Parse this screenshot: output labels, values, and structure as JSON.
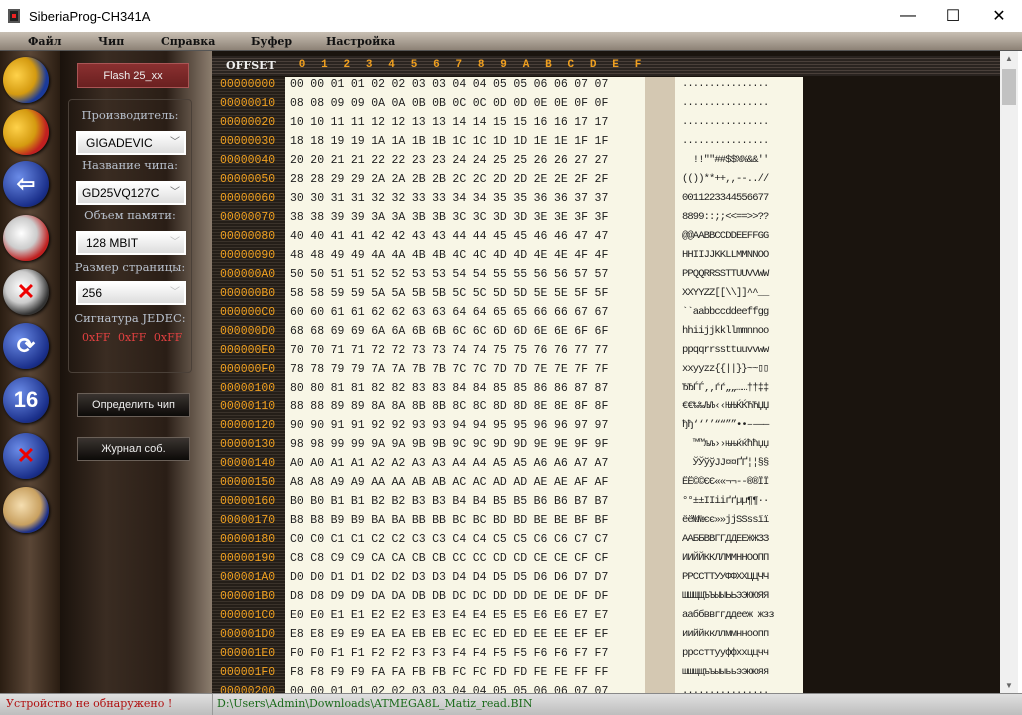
{
  "window": {
    "title": "SiberiaProg-CH341A",
    "minimize": "—",
    "maximize": "☐",
    "close": "✕"
  },
  "menu": [
    "Файл",
    "Чип",
    "Справка",
    "Буфер",
    "Настройка"
  ],
  "toolbar": [
    {
      "icon": "open-folder-icon"
    },
    {
      "icon": "save-folder-icon"
    },
    {
      "icon": "read-chip-icon"
    },
    {
      "icon": "write-chip-icon"
    },
    {
      "icon": "erase-chip-icon"
    },
    {
      "icon": "verify-icon"
    },
    {
      "icon": "hex-16-icon",
      "label": "16"
    },
    {
      "icon": "auto-program-icon"
    },
    {
      "icon": "edit-icon"
    }
  ],
  "panel": {
    "flash_button": "Flash 25_xx",
    "manufacturer_label": "Производитель:",
    "manufacturer": "GIGADEVIC",
    "chip_name_label": "Название чипа:",
    "chip_name": "GD25VQ127C",
    "memory_label": "Объем памяти:",
    "memory": "128 MBIT",
    "page_label": "Размер страницы:",
    "page_size": "256",
    "jedec_label": "Сигнатура JEDEC:",
    "jedec": "0xFF  0xFF  0xFF",
    "detect_button": "Определить чип",
    "log_button": "Журнал соб."
  },
  "hex": {
    "offset_header": "OFFSET",
    "columns": [
      "0",
      "1",
      "2",
      "3",
      "4",
      "5",
      "6",
      "7",
      "8",
      "9",
      "A",
      "B",
      "C",
      "D",
      "E",
      "F"
    ],
    "rows": [
      {
        "o": "00000000",
        "h": "00 00 01 01 02 02 03 03 04 04 05 05 06 06 07 07",
        "a": "................"
      },
      {
        "o": "00000010",
        "h": "08 08 09 09 0A 0A 0B 0B 0C 0C 0D 0D 0E 0E 0F 0F",
        "a": "................"
      },
      {
        "o": "00000020",
        "h": "10 10 11 11 12 12 13 13 14 14 15 15 16 16 17 17",
        "a": "................"
      },
      {
        "o": "00000030",
        "h": "18 18 19 19 1A 1A 1B 1B 1C 1C 1D 1D 1E 1E 1F 1F",
        "a": "................"
      },
      {
        "o": "00000040",
        "h": "20 20 21 21 22 22 23 23 24 24 25 25 26 26 27 27",
        "a": "  !!\"\"##$$%%&&''"
      },
      {
        "o": "00000050",
        "h": "28 28 29 29 2A 2A 2B 2B 2C 2C 2D 2D 2E 2E 2F 2F",
        "a": "(())**++,,--..//"
      },
      {
        "o": "00000060",
        "h": "30 30 31 31 32 32 33 33 34 34 35 35 36 36 37 37",
        "a": "0011223344556677"
      },
      {
        "o": "00000070",
        "h": "38 38 39 39 3A 3A 3B 3B 3C 3C 3D 3D 3E 3E 3F 3F",
        "a": "8899::;;<<==>>??"
      },
      {
        "o": "00000080",
        "h": "40 40 41 41 42 42 43 43 44 44 45 45 46 46 47 47",
        "a": "@@AABBCCDDEEFFGG"
      },
      {
        "o": "00000090",
        "h": "48 48 49 49 4A 4A 4B 4B 4C 4C 4D 4D 4E 4E 4F 4F",
        "a": "HHIIJJKKLLMMNNOO"
      },
      {
        "o": "000000A0",
        "h": "50 50 51 51 52 52 53 53 54 54 55 55 56 56 57 57",
        "a": "PPQQRRSSTTUUVVWW"
      },
      {
        "o": "000000B0",
        "h": "58 58 59 59 5A 5A 5B 5B 5C 5C 5D 5D 5E 5E 5F 5F",
        "a": "XXYYZZ[[\\\\]]^^__"
      },
      {
        "o": "000000C0",
        "h": "60 60 61 61 62 62 63 63 64 64 65 65 66 66 67 67",
        "a": "``aabbccddeeffgg"
      },
      {
        "o": "000000D0",
        "h": "68 68 69 69 6A 6A 6B 6B 6C 6C 6D 6D 6E 6E 6F 6F",
        "a": "hhiijjkkllmmnnoo"
      },
      {
        "o": "000000E0",
        "h": "70 70 71 71 72 72 73 73 74 74 75 75 76 76 77 77",
        "a": "ppqqrrssttuuvvww"
      },
      {
        "o": "000000F0",
        "h": "78 78 79 79 7A 7A 7B 7B 7C 7C 7D 7D 7E 7E 7F 7F",
        "a": "xxyyzz{{||}}~~▯▯"
      },
      {
        "o": "00000100",
        "h": "80 80 81 81 82 82 83 83 84 84 85 85 86 86 87 87",
        "a": "ЂЂЃЃ‚‚ѓѓ„„……††‡‡"
      },
      {
        "o": "00000110",
        "h": "88 88 89 89 8A 8A 8B 8B 8C 8C 8D 8D 8E 8E 8F 8F",
        "a": "€€‰‰ЉЉ‹‹ЊЊЌЌЋЋЏЏ"
      },
      {
        "o": "00000120",
        "h": "90 90 91 91 92 92 93 93 94 94 95 95 96 96 97 97",
        "a": "ђђ‘‘’’““””••––——"
      },
      {
        "o": "00000130",
        "h": "98 98 99 99 9A 9A 9B 9B 9C 9C 9D 9D 9E 9E 9F 9F",
        "a": "  ™™љљ››њњќќћћџџ"
      },
      {
        "o": "00000140",
        "h": "A0 A0 A1 A1 A2 A2 A3 A3 A4 A4 A5 A5 A6 A6 A7 A7",
        "a": "  ЎЎўўЈЈ¤¤ҐҐ¦¦§§"
      },
      {
        "o": "00000150",
        "h": "A8 A8 A9 A9 AA AA AB AB AC AC AD AD AE AE AF AF",
        "a": "ЁЁ©©ЄЄ««¬¬--®®ЇЇ"
      },
      {
        "o": "00000160",
        "h": "B0 B0 B1 B1 B2 B2 B3 B3 B4 B4 B5 B5 B6 B6 B7 B7",
        "a": "°°±±IIiiґґµµ¶¶··"
      },
      {
        "o": "00000170",
        "h": "B8 B8 B9 B9 BA BA BB BB BC BC BD BD BE BE BF BF",
        "a": "ёё№№єє»»jjSSssїї"
      },
      {
        "o": "00000180",
        "h": "C0 C0 C1 C1 C2 C2 C3 C3 C4 C4 C5 C5 C6 C6 C7 C7",
        "a": "ААББВВГГДДЕЕЖЖЗЗ"
      },
      {
        "o": "00000190",
        "h": "C8 C8 C9 C9 CA CA CB CB CC CC CD CD CE CE CF CF",
        "a": "ИИЙЙККЛЛММННООПП"
      },
      {
        "o": "000001A0",
        "h": "D0 D0 D1 D1 D2 D2 D3 D3 D4 D4 D5 D5 D6 D6 D7 D7",
        "a": "РРССТТУУФФХХЦЦЧЧ"
      },
      {
        "o": "000001B0",
        "h": "D8 D8 D9 D9 DA DA DB DB DC DC DD DD DE DE DF DF",
        "a": "ШШЩЩЪЪЫЫЬЬЭЭЮЮЯЯ"
      },
      {
        "o": "000001C0",
        "h": "E0 E0 E1 E1 E2 E2 E3 E3 E4 E4 E5 E5 E6 E6 E7 E7",
        "a": "ааббввггддееж жзз"
      },
      {
        "o": "000001D0",
        "h": "E8 E8 E9 E9 EA EA EB EB EC EC ED ED EE EE EF EF",
        "a": "ииййккллммннoопп"
      },
      {
        "o": "000001E0",
        "h": "F0 F0 F1 F1 F2 F2 F3 F3 F4 F4 F5 F5 F6 F6 F7 F7",
        "a": "ррссттууффххццчч"
      },
      {
        "o": "000001F0",
        "h": "F8 F8 F9 F9 FA FA FB FB FC FC FD FD FE FE FF FF",
        "a": "шшщщъъыыььээююяя"
      },
      {
        "o": "00000200",
        "h": "00 00 01 01 02 02 03 03 04 04 05 05 06 06 07 07",
        "a": "................"
      }
    ]
  },
  "status": {
    "left": "Устройство не обнаружено !",
    "right": "D:\\Users\\Admin\\Downloads\\ATMEGA8L_Matiz_read.BIN"
  }
}
